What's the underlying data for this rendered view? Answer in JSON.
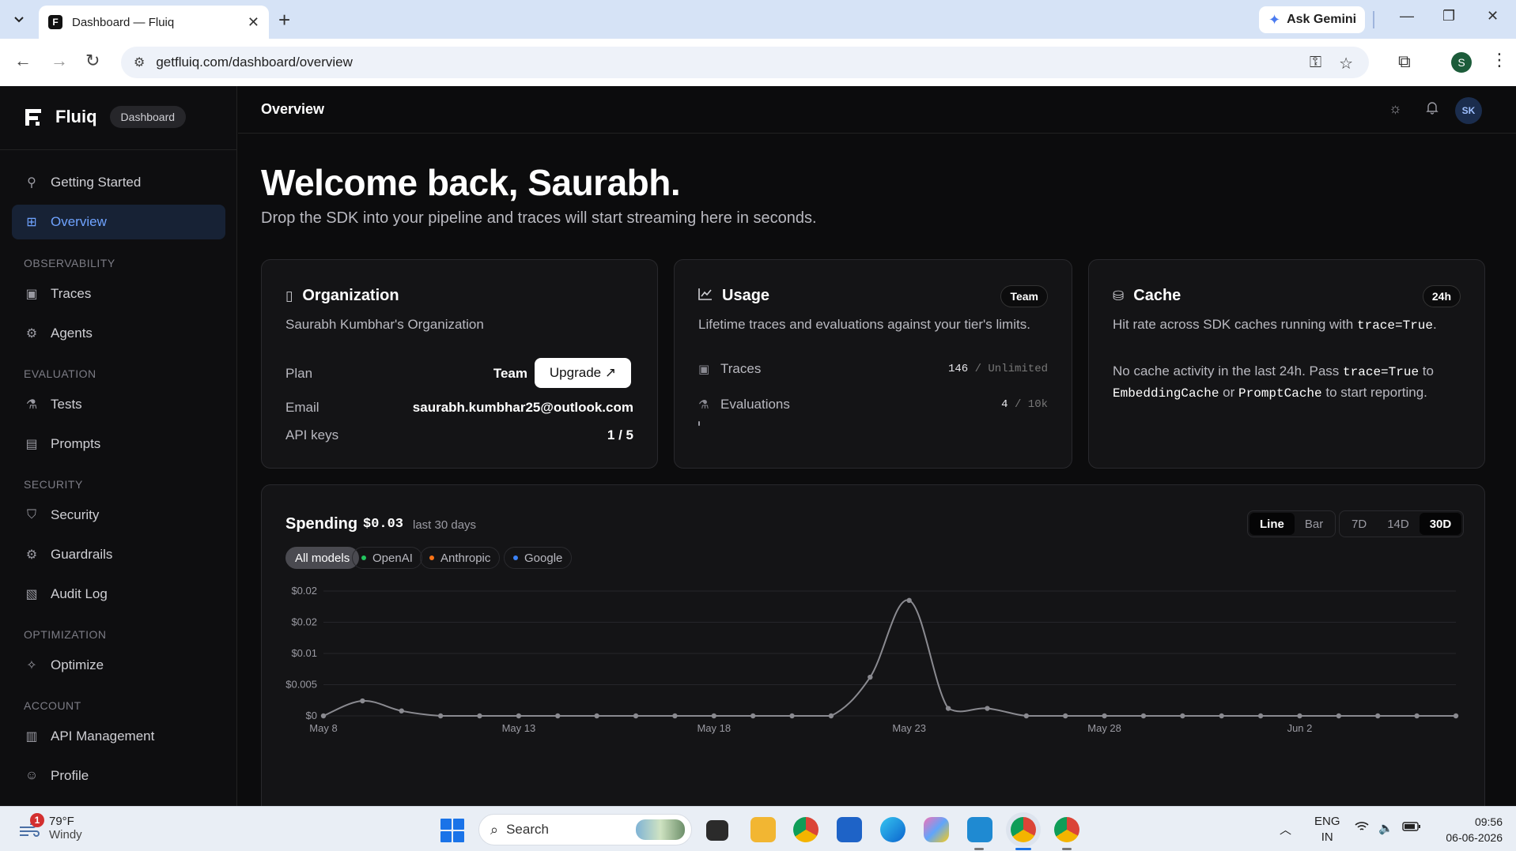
{
  "browser": {
    "tab_title": "Dashboard — Fluiq",
    "url": "getfluiq.com/dashboard/overview",
    "gemini_label": "Ask Gemini",
    "profile_initial": "S"
  },
  "sidebar": {
    "brand": "Fluiq",
    "badge": "Dashboard",
    "items": [
      {
        "label": "Getting Started",
        "icon": "rocket-icon"
      },
      {
        "label": "Overview",
        "icon": "grid-icon",
        "active": true
      }
    ],
    "sections": [
      {
        "title": "OBSERVABILITY",
        "items": [
          {
            "label": "Traces",
            "icon": "activity-icon"
          },
          {
            "label": "Agents",
            "icon": "bot-icon"
          }
        ]
      },
      {
        "title": "EVALUATION",
        "items": [
          {
            "label": "Tests",
            "icon": "flask-icon"
          },
          {
            "label": "Prompts",
            "icon": "document-icon"
          }
        ]
      },
      {
        "title": "SECURITY",
        "items": [
          {
            "label": "Security",
            "icon": "shield-icon"
          },
          {
            "label": "Guardrails",
            "icon": "gear-icon"
          },
          {
            "label": "Audit Log",
            "icon": "log-icon"
          }
        ]
      },
      {
        "title": "OPTIMIZATION",
        "items": [
          {
            "label": "Optimize",
            "icon": "wand-icon"
          }
        ]
      },
      {
        "title": "ACCOUNT",
        "items": [
          {
            "label": "API Management",
            "icon": "api-icon"
          },
          {
            "label": "Profile",
            "icon": "user-icon"
          }
        ]
      }
    ]
  },
  "topbar": {
    "title": "Overview",
    "avatar": "SK"
  },
  "main": {
    "welcome": "Welcome back, Saurabh.",
    "subtitle": "Drop the SDK into your pipeline and traces will start streaming here in seconds."
  },
  "org_card": {
    "title": "Organization",
    "org_name": "Saurabh Kumbhar's Organization",
    "plan_label": "Plan",
    "plan_value": "Team",
    "upgrade_label": "Upgrade ↗",
    "email_label": "Email",
    "email_value": "saurabh.kumbhar25@outlook.com",
    "apikeys_label": "API keys",
    "apikeys_value": "1 / 5"
  },
  "usage_card": {
    "title": "Usage",
    "chip": "Team",
    "desc": "Lifetime traces and evaluations against your tier's limits.",
    "traces_label": "Traces",
    "traces_used": "146",
    "traces_limit": "/ Unlimited",
    "evals_label": "Evaluations",
    "evals_used": "4",
    "evals_limit": "/ 10k",
    "evals_progress_fraction": 0.0004
  },
  "cache_card": {
    "title": "Cache",
    "chip": "24h",
    "desc_prefix": "Hit rate across SDK caches running with",
    "desc_code": "trace=True",
    "desc_suffix": ".",
    "body_1": "No cache activity in the last 24h. Pass",
    "body_code1": "trace=True",
    "body_2": "to",
    "body_code2": "EmbeddingCache",
    "body_3": "or",
    "body_code3": "PromptCache",
    "body_4": "to start reporting."
  },
  "spending": {
    "title": "Spending",
    "amount": "$0.03",
    "range": "last 30 days",
    "filters": [
      {
        "label": "All models",
        "active": true
      },
      {
        "label": "OpenAI",
        "color": "#22c55e"
      },
      {
        "label": "Anthropic",
        "color": "#f97316"
      },
      {
        "label": "Google",
        "color": "#3b82f6"
      }
    ],
    "chart_types": [
      {
        "label": "Line",
        "active": true
      },
      {
        "label": "Bar"
      }
    ],
    "ranges": [
      {
        "label": "7D"
      },
      {
        "label": "14D"
      },
      {
        "label": "30D",
        "active": true
      }
    ]
  },
  "chart_data": {
    "type": "line",
    "title": "",
    "xlabel": "",
    "ylabel": "",
    "y_ticks": [
      "$0",
      "$0.005",
      "$0.01",
      "$0.02",
      "$0.02"
    ],
    "y_tick_values": [
      0,
      0.005,
      0.01,
      0.015,
      0.02
    ],
    "ylim": [
      0,
      0.02
    ],
    "x_tick_labels": [
      "May 8",
      "May 13",
      "May 18",
      "May 23",
      "May 28",
      "Jun 2"
    ],
    "x": [
      "May 8",
      "May 9",
      "May 10",
      "May 11",
      "May 12",
      "May 13",
      "May 14",
      "May 15",
      "May 16",
      "May 17",
      "May 18",
      "May 19",
      "May 20",
      "May 21",
      "May 22",
      "May 23",
      "May 24",
      "May 25",
      "May 26",
      "May 27",
      "May 28",
      "May 29",
      "May 30",
      "May 31",
      "Jun 1",
      "Jun 2",
      "Jun 3",
      "Jun 4",
      "Jun 5",
      "Jun 6"
    ],
    "series": [
      {
        "values": [
          0,
          0.0024,
          0.0008,
          0,
          0,
          0,
          0,
          0,
          0,
          0,
          0,
          0,
          0,
          0,
          0.0062,
          0.0185,
          0.0012,
          0.0012,
          0,
          0,
          0,
          0,
          0,
          0,
          0,
          0,
          0,
          0,
          0,
          0
        ]
      }
    ],
    "grid": true
  },
  "taskbar": {
    "weather_temp": "79°F",
    "weather_desc": "Windy",
    "weather_badge": "1",
    "search_placeholder": "Search",
    "lang_1": "ENG",
    "lang_2": "IN",
    "time": "09:56",
    "date": "06-06-2026"
  }
}
